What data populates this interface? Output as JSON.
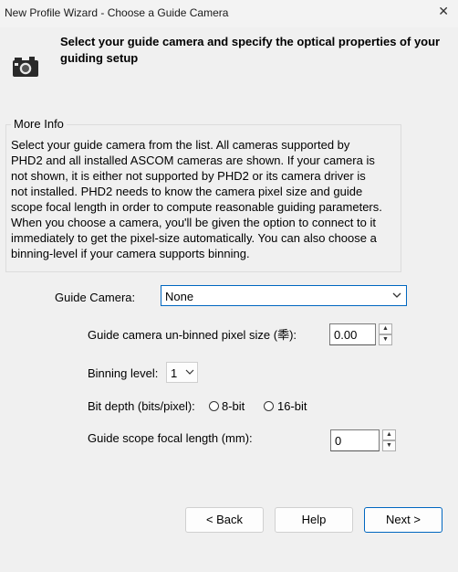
{
  "window": {
    "title": "New Profile Wizard - Choose a Guide Camera",
    "close_glyph": "✕"
  },
  "header": {
    "text": "Select your guide camera and specify the optical properties of your guiding setup",
    "icon": "camera-icon"
  },
  "more_info": {
    "title": "More Info",
    "body": "Select your guide camera from the list.  All cameras supported by PHD2 and all installed ASCOM cameras are shown. If your camera is not shown, it is either not supported by PHD2 or its camera driver is not installed.  PHD2 needs to know the camera pixel size and guide scope focal length in order to compute reasonable guiding parameters.  When you choose a camera, you'll be given the option to connect to it immediately to get the pixel-size automatically.  You can also choose a binning-level if your camera supports binning."
  },
  "form": {
    "guide_camera_label": "Guide Camera:",
    "guide_camera_value": "None",
    "pixel_size_label": "Guide camera un-binned pixel size (䄹):",
    "pixel_size_value": "0.00",
    "binning_label": "Binning level:",
    "binning_value": "1",
    "bit_depth_label": "Bit depth (bits/pixel):",
    "bit_depth_options": [
      "8-bit",
      "16-bit"
    ],
    "focal_length_label": "Guide scope focal length (mm):",
    "focal_length_value": "0"
  },
  "buttons": {
    "back": "< Back",
    "help": "Help",
    "next": "Next >"
  }
}
